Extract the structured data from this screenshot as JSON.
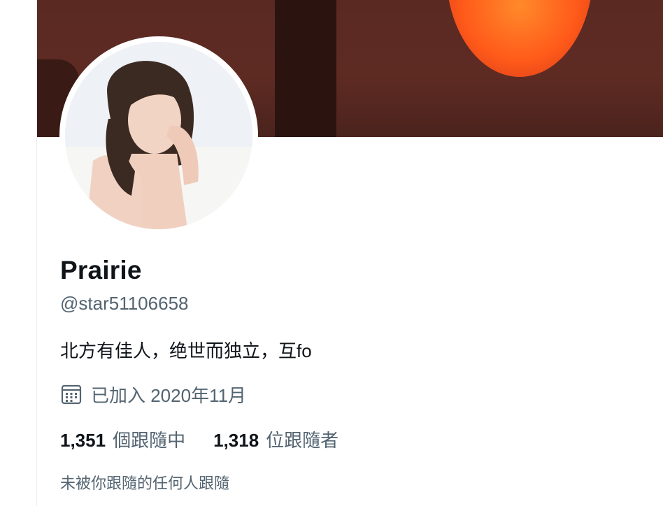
{
  "profile": {
    "name": "Prairie",
    "handle": "@star51106658",
    "bio": "北方有佳人，绝世而独立，互fo",
    "joined": "已加入 2020年11月"
  },
  "stats": {
    "following_count": "1,351",
    "following_label": "個跟隨中",
    "followers_count": "1,318",
    "followers_label": "位跟隨者"
  },
  "followed_by_text": "未被你跟隨的任何人跟隨",
  "icons": {
    "joined": "calendar-icon"
  },
  "colors": {
    "text_primary": "#0f1419",
    "text_secondary": "#536471",
    "banner": "#5a2a22",
    "banner_sun": "#ff5a1a"
  }
}
